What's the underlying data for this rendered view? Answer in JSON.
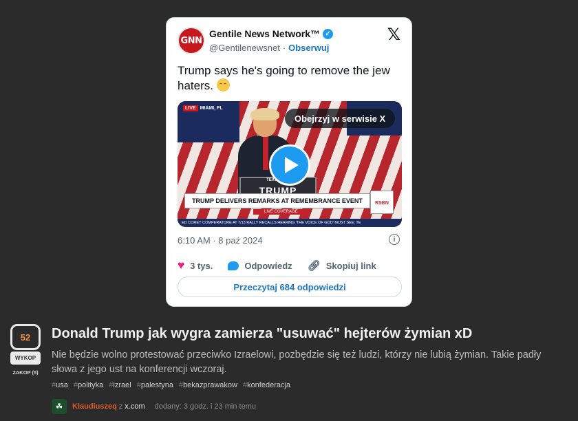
{
  "tweet": {
    "avatar_text": "GNN",
    "author_name": "Gentile News Network™",
    "handle": "@Gentilenewsnet",
    "separator": "·",
    "follow_label": "Obserwuj",
    "text": "Trump says he's going to remove the jew haters.",
    "emoji": "relieved-face-emoji",
    "media": {
      "view_on_x_label": "Obejrzyj w serwisie X",
      "live_badge": "LIVE",
      "live_location": "MIAMI, FL",
      "podium_text": "TRUMP",
      "podium_small": "TEXT 88022",
      "banner": "TRUMP DELIVERS REMARKS AT REMEMBRANCE EVENT",
      "live_coverage": "LIVE COVERAGE",
      "ticker": "ED COREY COMPERATORE AT 7/13 RALLY RECALLS HEARING 'THE VOICE OF GOD'   MUST SEE: TE",
      "rsbn": "RSBN"
    },
    "timestamp": "6:10 AM · 8 paź 2024",
    "likes": "3 tys.",
    "reply_label": "Odpowiedz",
    "copy_link_label": "Skopiuj link",
    "read_replies_label": "Przeczytaj 684 odpowiedzi",
    "colors": {
      "accent": "#1d9bf0",
      "like": "#f91880",
      "brand_red": "#c8181e"
    }
  },
  "entry": {
    "votes": "52",
    "wykop_label": "WYKOP",
    "zakop_label": "ZAKOP (5)",
    "title": "Donald Trump jak wygra zamierza \"usuwać\" hejterów żymian xD",
    "description": "Nie będzie wolno protestować przeciwko Izraelowi, pozbędzie się też ludzi, którzy nie lubią żymian. Takie padły słowa z jego ust na konferencji wczoraj.",
    "tags": [
      "usa",
      "polityka",
      "izrael",
      "palestyna",
      "bekazprawakow",
      "konfederacja"
    ],
    "author": "Klaudiuszeq",
    "from_word": "z",
    "source": "x.com",
    "added": "dodany: 3 godz. i 23 min temu",
    "colors": {
      "votes": "#f48f3f",
      "author": "#e05b2a"
    }
  }
}
